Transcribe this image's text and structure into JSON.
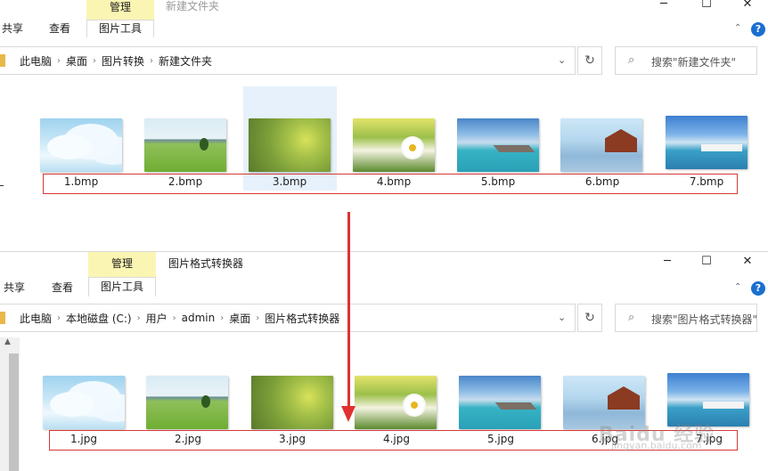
{
  "window1": {
    "ribbon": {
      "tab_share": "共享",
      "tab_view": "查看",
      "manage": "管理",
      "picture_tools": "图片工具"
    },
    "title": "新建文件夹",
    "breadcrumb": [
      "此电脑",
      "桌面",
      "图片转换",
      "新建文件夹"
    ],
    "search_placeholder": "搜索\"新建文件夹\"",
    "files": [
      "1.bmp",
      "2.bmp",
      "3.bmp",
      "4.bmp",
      "5.bmp",
      "6.bmp",
      "7.bmp"
    ],
    "selected_index": 2
  },
  "window2": {
    "ribbon": {
      "tab_share": "共享",
      "tab_view": "查看",
      "manage": "管理",
      "picture_tools": "图片工具"
    },
    "title": "图片格式转换器",
    "breadcrumb": [
      "此电脑",
      "本地磁盘 (C:)",
      "用户",
      "admin",
      "桌面",
      "图片格式转换器"
    ],
    "search_placeholder": "搜索\"图片格式转换器\"",
    "files": [
      "1.jpg",
      "2.jpg",
      "3.jpg",
      "4.jpg",
      "5.jpg",
      "6.jpg",
      "7.jpg"
    ]
  },
  "icons": {
    "minimize": "minimize-icon",
    "maximize": "maximize-icon",
    "close": "close-icon",
    "help": "help-icon",
    "refresh": "refresh-icon",
    "search": "search-icon",
    "dropdown": "chevron-down-icon",
    "collapse": "chevron-up-icon"
  },
  "colors": {
    "manage_highlight": "#fbf5b3",
    "selection": "#e6f1fb",
    "annotation_red": "#e03131",
    "help_blue": "#1a6fd0"
  },
  "watermark": {
    "brand": "Baidu 经验",
    "url": "jingyan.baidu.com"
  }
}
